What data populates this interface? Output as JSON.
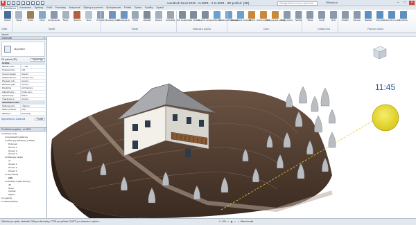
{
  "window": {
    "title": "Autodesk Revit 2015 - m.0001 - 3 m.0001 - 3D pohled: {3D}",
    "search_placeholder": "Zadejte klíčové slovo nebo frázi",
    "user_label": "Přihlásit se"
  },
  "ribbon_tabs": [
    "Architektura",
    "Konstrukce",
    "Systémy",
    "Vložit",
    "Poznámky",
    "Analyzovat",
    "Objemy a pozemek",
    "Spolupracovat",
    "Pohled",
    "Správa",
    "Doplňky",
    "Upravit"
  ],
  "ribbon": {
    "buttons": [
      {
        "label": "Upravit",
        "icon": "modify-arrow-icon",
        "color": "#4a6f99"
      },
      {
        "label": "Stěna",
        "icon": "wall-icon",
        "color": "#a9b6c6"
      },
      {
        "label": "Dveře",
        "icon": "door-icon",
        "color": "#9c7f5b"
      },
      {
        "label": "Okno",
        "icon": "window-icon",
        "color": "#84a8cc"
      },
      {
        "label": "Komponenta",
        "icon": "component-icon",
        "color": "#8a9aac"
      },
      {
        "label": "Sloup",
        "icon": "column-icon",
        "color": "#a7b2be"
      },
      {
        "label": "Střecha",
        "icon": "roof-icon",
        "color": "#b0613f"
      },
      {
        "label": "Strop",
        "icon": "ceiling-icon",
        "color": "#b8c4d0"
      },
      {
        "label": "Podlaha",
        "icon": "floor-icon",
        "color": "#8e9eb0"
      },
      {
        "label": "Obvodový plášť",
        "icon": "curtain-system-icon",
        "color": "#6f95bf"
      },
      {
        "label": "Obvodová síť",
        "icon": "curtain-grid-icon",
        "color": "#6f95bf"
      },
      {
        "label": "Příčel",
        "icon": "mullion-icon",
        "color": "#9aa7b5"
      },
      {
        "label": "Zábradlí",
        "icon": "railing-icon",
        "color": "#7b8a99"
      },
      {
        "label": "Rampa",
        "icon": "ramp-icon",
        "color": "#a4b0bd"
      },
      {
        "label": "Schodiště",
        "icon": "stair-icon",
        "color": "#9aa6b3"
      },
      {
        "label": "Text modelu",
        "icon": "model-text-icon",
        "color": "#7f8d9b"
      },
      {
        "label": "Čára modelu",
        "icon": "model-line-icon",
        "color": "#7f8d9b"
      },
      {
        "label": "Skupina modelu",
        "icon": "model-group-icon",
        "color": "#7f8d9b"
      },
      {
        "label": "Místnost",
        "icon": "room-icon",
        "color": "#6ea0c8"
      },
      {
        "label": "Oddělovač místností",
        "icon": "room-separator-icon",
        "color": "#6ea0c8"
      },
      {
        "label": "Vložit popisek místnosti",
        "icon": "room-tag-icon",
        "color": "#6ea0c8"
      },
      {
        "label": "Plocha",
        "icon": "area-icon",
        "color": "#c9883f"
      },
      {
        "label": "Hranice plochy",
        "icon": "area-boundary-icon",
        "color": "#c9883f"
      },
      {
        "label": "Vložit popisek plochy",
        "icon": "area-tag-icon",
        "color": "#c9883f"
      },
      {
        "label": "Podle plochy",
        "icon": "by-face-icon",
        "color": "#8a9aac"
      },
      {
        "label": "Šachta",
        "icon": "shaft-icon",
        "color": "#8a9aac"
      },
      {
        "label": "Stěna",
        "icon": "wall-opening-icon",
        "color": "#8a9aac"
      },
      {
        "label": "Svislý",
        "icon": "vertical-opening-icon",
        "color": "#8a9aac"
      },
      {
        "label": "Vikýř",
        "icon": "dormer-icon",
        "color": "#8a9aac"
      },
      {
        "label": "Podlaží",
        "icon": "level-icon",
        "color": "#8a9aac"
      },
      {
        "label": "Osnova",
        "icon": "grid-icon",
        "color": "#8a9aac"
      },
      {
        "label": "Nastavit",
        "icon": "set-workplane-icon",
        "color": "#5f8fbf"
      },
      {
        "label": "Zobrazit",
        "icon": "show-workplane-icon",
        "color": "#5f8fbf"
      },
      {
        "label": "Referenční rovina",
        "icon": "ref-plane-icon",
        "color": "#5f8fbf"
      },
      {
        "label": "Prohlížeč",
        "icon": "viewer-icon",
        "color": "#5f8fbf"
      }
    ],
    "panels": [
      "Výběr",
      "Stavět",
      "Model",
      "Místnost a plocha",
      "Otvor",
      "Vztažný bod",
      "Pracovní rovina"
    ]
  },
  "options_bar": {
    "modify_label": "Upravit"
  },
  "properties": {
    "title": "Vlastnosti",
    "type_name": "3D pohled",
    "selector": "3D pohled: {3D}",
    "edit_type_label": "Upravit typ",
    "rows": [
      {
        "k": "Grafika",
        "v": "",
        "group": true
      },
      {
        "k": "Měřítko pohl...",
        "v": "1 : 100",
        "group": false
      },
      {
        "k": "Hodnota měř...",
        "v": "100",
        "group": false
      },
      {
        "k": "Úroveň detailu",
        "v": "Střední",
        "group": false
      },
      {
        "k": "Viditelnost sou...",
        "v": "Zobrazit oriq...",
        "group": false
      },
      {
        "k": "Přepsání vidi...",
        "v": "Upravit...",
        "group": false
      },
      {
        "k": "Možnosti graf...",
        "v": "Upravit...",
        "group": false
      },
      {
        "k": "Disciplína",
        "v": "Architektura",
        "group": false
      },
      {
        "k": "Zobrazit skry...",
        "v": "Podle disci...",
        "group": false
      },
      {
        "k": "Výchozí styl...",
        "v": "Žádné",
        "group": false
      },
      {
        "k": "Trajektorie sl...",
        "v": "Upravit...",
        "group": false
      },
      {
        "k": "Identifikační data",
        "v": "",
        "group": true
      },
      {
        "k": "Šablona pohl...",
        "v": "<Žádné>",
        "group": false
      },
      {
        "k": "Název pohledu",
        "v": "{3D}",
        "group": false
      },
      {
        "k": "Závislost",
        "v": "Nezávislý",
        "group": false
      }
    ],
    "help_link": "Nápověda pro vlastnosti",
    "apply_label": "Použít"
  },
  "browser": {
    "title": "Prohlížeč projektu - m.0001",
    "items": [
      {
        "label": "Pohledy (vše)",
        "depth": 0,
        "bold": false
      },
      {
        "label": "Konstrukční půdorysy",
        "depth": 1,
        "bold": false
      },
      {
        "label": "Půdorysy (Půdorysy podlaží)",
        "depth": 1,
        "bold": false
      },
      {
        "label": "Pozemek",
        "depth": 2,
        "bold": false
      },
      {
        "label": "Úroveň 1",
        "depth": 2,
        "bold": false
      },
      {
        "label": "Úroveň 2",
        "depth": 2,
        "bold": false
      },
      {
        "label": "Úroveň 3",
        "depth": 2,
        "bold": false
      },
      {
        "label": "Půdorysy stropů",
        "depth": 1,
        "bold": false
      },
      {
        "label": "ok",
        "depth": 2,
        "bold": false
      },
      {
        "label": "Úroveň 1",
        "depth": 2,
        "bold": false
      },
      {
        "label": "Úroveň 2",
        "depth": 2,
        "bold": false
      },
      {
        "label": "Úroveň 3",
        "depth": 2,
        "bold": false
      },
      {
        "label": "3D pohledy",
        "depth": 1,
        "bold": false
      },
      {
        "label": "{3D}",
        "depth": 2,
        "bold": true
      },
      {
        "label": "Pohledy (Výška budovy)",
        "depth": 1,
        "bold": false
      },
      {
        "label": "Jih",
        "depth": 2,
        "bold": false
      },
      {
        "label": "Sever",
        "depth": 2,
        "bold": false
      },
      {
        "label": "Východ",
        "depth": 2,
        "bold": false
      },
      {
        "label": "Západ",
        "depth": 2,
        "bold": false
      },
      {
        "label": "Legendy",
        "depth": 0,
        "bold": false
      },
      {
        "label": "Výkazy/výkazy",
        "depth": 0,
        "bold": false
      }
    ]
  },
  "viewport": {
    "clock_text": "11:45",
    "cube_label": "ZÁPAD",
    "sun_color": "#ecdf2b",
    "terrain_color": "#4e3a2e"
  },
  "statusbar": {
    "text": "Klikněte pro výběr, stiskněte TAB pro alternativy, CTRL pro přidání, SHIFT pro odebrání z výběru.",
    "scale": "1 : 100",
    "model_label": "Hlavní model"
  }
}
